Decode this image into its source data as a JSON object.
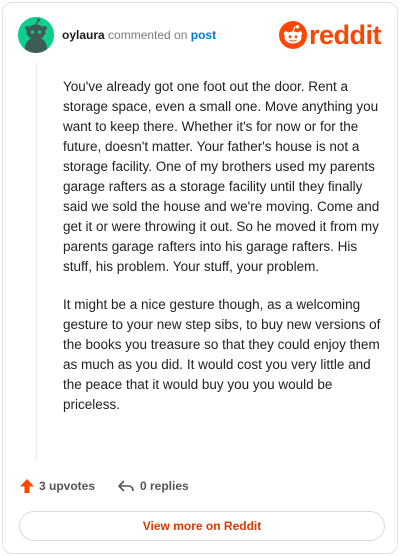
{
  "header": {
    "username": "oylaura",
    "action_text": "commented on",
    "post_link": "post",
    "brand": "reddit",
    "avatar_icon": "snoo-avatar-icon",
    "brand_color": "#ff4500"
  },
  "comment": {
    "paragraphs": [
      "You've already got one foot out the door. Rent a storage space, even a small one. Move anything you want to keep there. Whether it's for now or for the future, doesn't matter. Your father's house is not a storage facility. One of my brothers used my parents garage rafters as a storage facility until they finally said we sold the house and we're moving. Come and get it or were throwing it out. So he moved it from my parents garage rafters into his garage rafters. His stuff, his problem. Your stuff, your problem.",
      "It might be a nice gesture though, as a welcoming gesture to your new step sibs, to buy new versions of the books you treasure so that they could enjoy them as much as you did. It would cost you very little and the peace that it would buy you you would be priceless."
    ]
  },
  "actions": {
    "upvotes_label": "3 upvotes",
    "replies_label": "0 replies",
    "upvote_icon": "upvote-arrow-icon",
    "reply_icon": "reply-icon"
  },
  "footer": {
    "view_more_label": "View more on Reddit"
  }
}
